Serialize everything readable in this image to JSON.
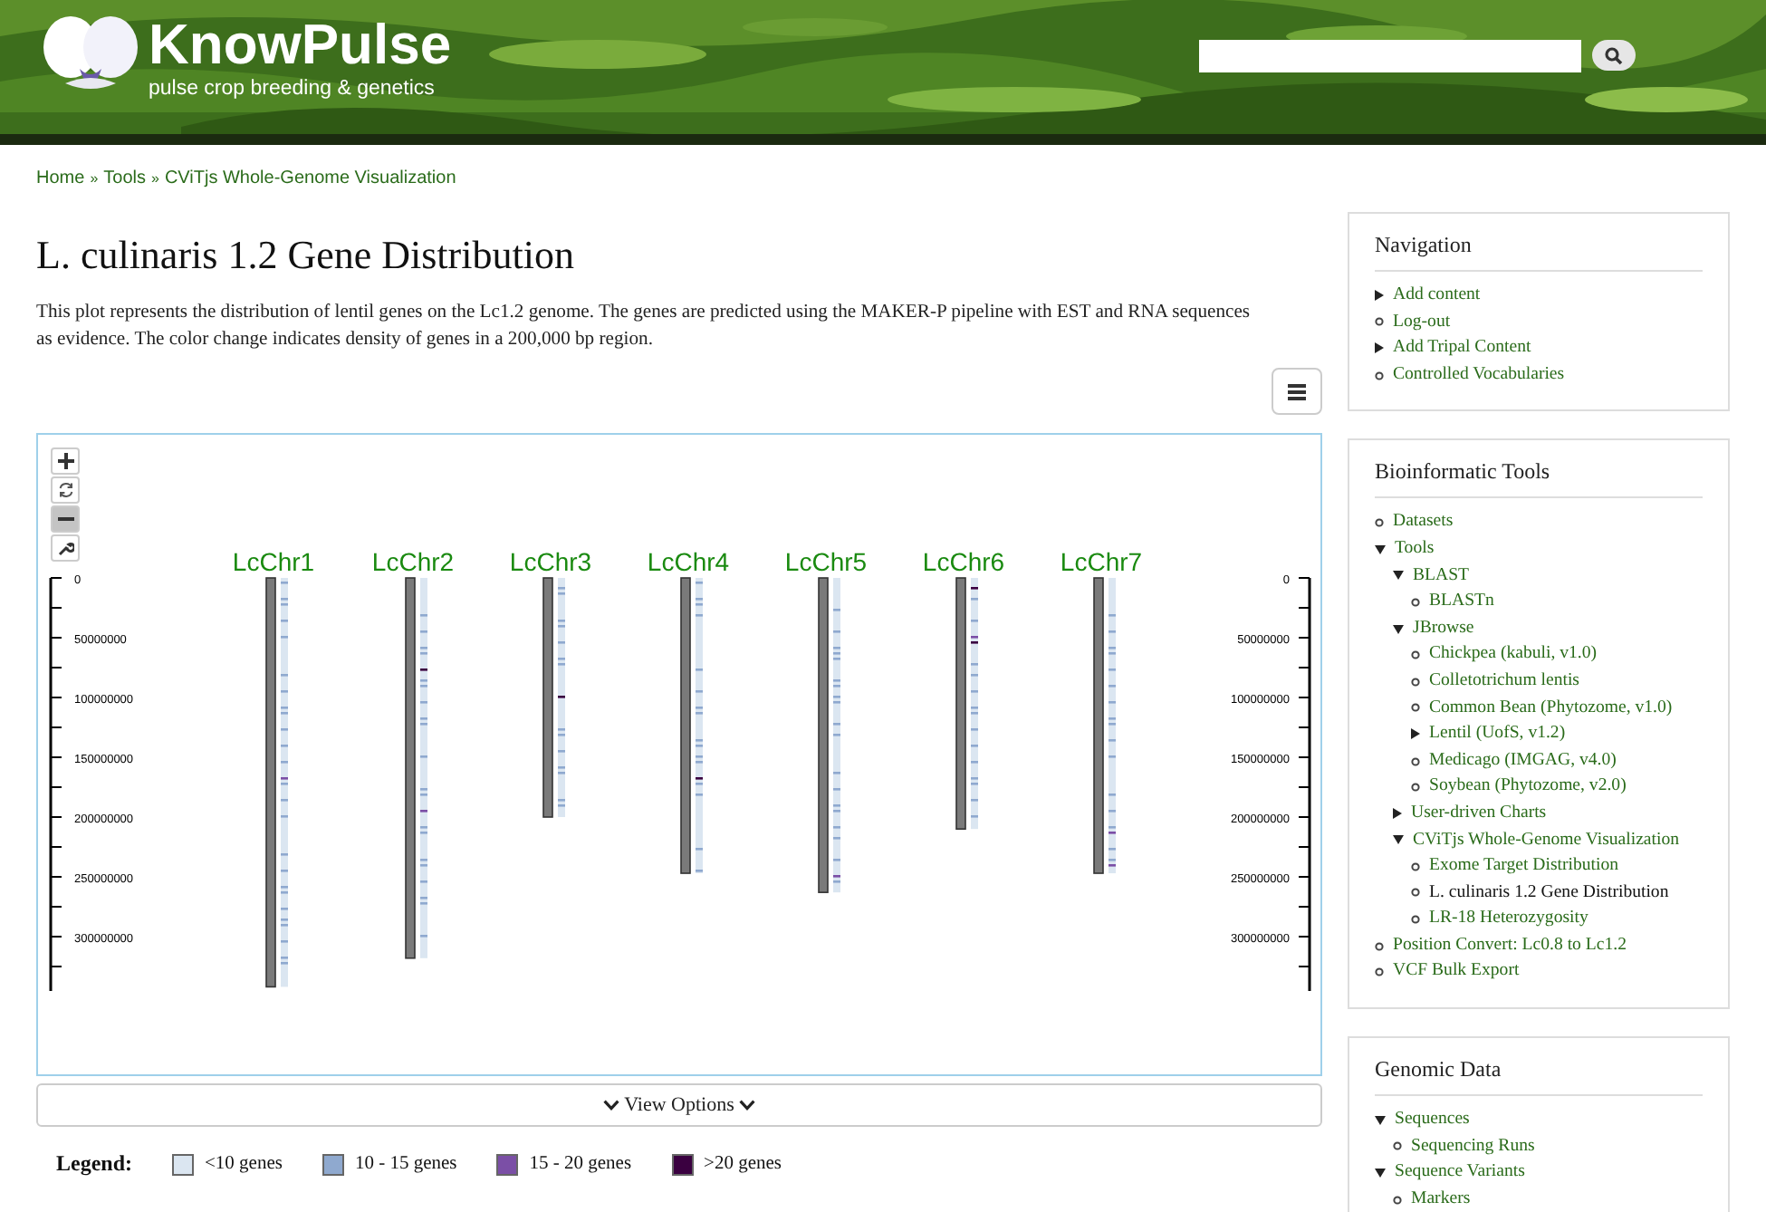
{
  "header": {
    "brand": "KnowPulse",
    "tagline": "pulse crop breeding & genetics"
  },
  "breadcrumb": [
    "Home",
    "Tools",
    "CViTjs Whole-Genome Visualization"
  ],
  "breadcrumb_separator": "»",
  "title": "L. culinaris 1.2 Gene Distribution",
  "description": "This plot represents the distribution of lentil genes on the Lc1.2 genome. The genes are predicted using the MAKER-P pipeline with EST and RNA sequences as evidence. The color change indicates density of genes in a 200,000 bp region.",
  "plot": {
    "zoom_controls": [
      {
        "kind": "zoom-in",
        "disabled": false
      },
      {
        "kind": "reset",
        "disabled": false
      },
      {
        "kind": "zoom-out",
        "disabled": true
      },
      {
        "kind": "settings",
        "disabled": false
      }
    ],
    "left_axis_ticks": [
      "0",
      "50000000",
      "100000000",
      "150000000",
      "200000000",
      "250000000",
      "300000000"
    ],
    "right_axis_ticks": [
      "0",
      "50000000",
      "100000000",
      "150000000",
      "200000000",
      "250000000",
      "300000000"
    ],
    "chromosomes": [
      {
        "name": "LcChr1"
      },
      {
        "name": "LcChr2"
      },
      {
        "name": "LcChr3"
      },
      {
        "name": "LcChr4"
      },
      {
        "name": "LcChr5"
      },
      {
        "name": "LcChr6"
      },
      {
        "name": "LcChr7"
      }
    ]
  },
  "view_options": "View Options",
  "legend": {
    "title": "Legend:",
    "items": [
      {
        "label": "<10 genes",
        "color": "#dbe6f1"
      },
      {
        "label": "10 - 15 genes",
        "color": "#8fa9cf"
      },
      {
        "label": "15 - 20 genes",
        "color": "#7b4fa6"
      },
      {
        "label": ">20 genes",
        "color": "#3a0040"
      }
    ]
  },
  "sidebar": [
    {
      "title": "Navigation",
      "items": [
        {
          "label": "Add content",
          "kind": "collapsed",
          "selected": false
        },
        {
          "label": "Log-out",
          "kind": "leaf",
          "selected": false
        },
        {
          "label": "Add Tripal Content",
          "kind": "collapsed",
          "selected": false
        },
        {
          "label": "Controlled Vocabularies",
          "kind": "leaf",
          "selected": false
        }
      ]
    },
    {
      "title": "Bioinformatic Tools",
      "items": [
        {
          "label": "Datasets",
          "kind": "leaf",
          "selected": false
        },
        {
          "label": "Tools",
          "kind": "expanded",
          "selected": false,
          "children": [
            {
              "label": "BLAST",
              "kind": "expanded",
              "selected": false,
              "children": [
                {
                  "label": "BLASTn",
                  "kind": "leaf",
                  "selected": false
                }
              ]
            },
            {
              "label": "JBrowse",
              "kind": "expanded",
              "selected": false,
              "children": [
                {
                  "label": "Chickpea (kabuli, v1.0)",
                  "kind": "leaf",
                  "selected": false
                },
                {
                  "label": "Colletotrichum lentis",
                  "kind": "leaf",
                  "selected": false
                },
                {
                  "label": "Common Bean (Phytozome, v1.0)",
                  "kind": "leaf",
                  "selected": false
                },
                {
                  "label": "Lentil (UofS, v1.2)",
                  "kind": "collapsed",
                  "selected": false
                },
                {
                  "label": "Medicago (IMGAG, v4.0)",
                  "kind": "leaf",
                  "selected": false
                },
                {
                  "label": "Soybean (Phytozome, v2.0)",
                  "kind": "leaf",
                  "selected": false
                }
              ]
            },
            {
              "label": "User-driven Charts",
              "kind": "collapsed",
              "selected": false
            },
            {
              "label": "CViTjs Whole-Genome Visualization",
              "kind": "expanded",
              "selected": false,
              "children": [
                {
                  "label": "Exome Target Distribution",
                  "kind": "leaf",
                  "selected": false
                },
                {
                  "label": "L. culinaris 1.2 Gene Distribution",
                  "kind": "leaf",
                  "selected": true
                },
                {
                  "label": "LR-18 Heterozygosity",
                  "kind": "leaf",
                  "selected": false
                }
              ]
            }
          ]
        },
        {
          "label": "Position Convert: Lc0.8 to Lc1.2",
          "kind": "leaf",
          "selected": false
        },
        {
          "label": "VCF Bulk Export",
          "kind": "leaf",
          "selected": false
        }
      ]
    },
    {
      "title": "Genomic Data",
      "items": [
        {
          "label": "Sequences",
          "kind": "expanded",
          "selected": false,
          "children": [
            {
              "label": "Sequencing Runs",
              "kind": "leaf",
              "selected": false
            }
          ]
        },
        {
          "label": "Sequence Variants",
          "kind": "expanded",
          "selected": false,
          "children": [
            {
              "label": "Markers",
              "kind": "leaf",
              "selected": false
            }
          ]
        }
      ]
    }
  ]
}
